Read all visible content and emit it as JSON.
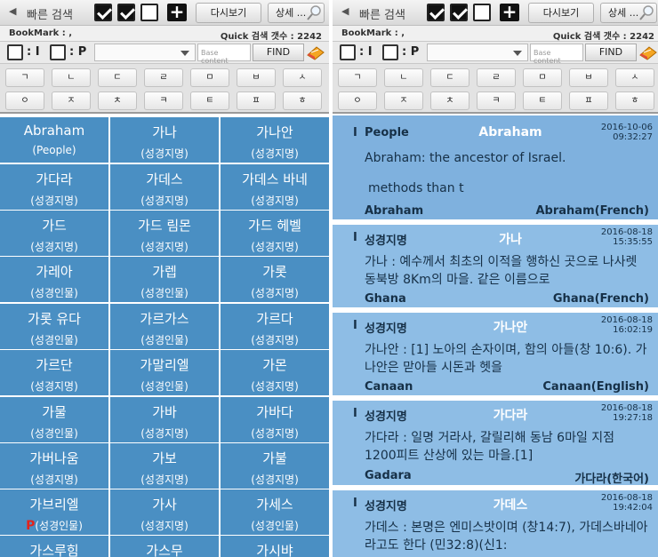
{
  "toolbar": {
    "back_glyph": "◀",
    "title": "빠른 검색",
    "checkboxes": [
      true,
      true,
      false
    ],
    "plus_glyph": "+",
    "review_label": "다시보기",
    "detail_label": "상세 ..."
  },
  "bookmark": {
    "label": "BookMark : ,",
    "quick_count_label": "Quick 검색 갯수 : 2242"
  },
  "search_row": {
    "i_label": ": I",
    "p_label": ": P",
    "placeholder": "Base content",
    "find_label": "FIND"
  },
  "keyboard": {
    "row1": [
      "ㄱ",
      "ㄴ",
      "ㄷ",
      "ㄹ",
      "ㅁ",
      "ㅂ",
      "ㅅ"
    ],
    "row2": [
      "ㅇ",
      "ㅈ",
      "ㅊ",
      "ㅋ",
      "ㅌ",
      "ㅍ",
      "ㅎ"
    ]
  },
  "grid": [
    {
      "name": "Abraham",
      "cat": "(People)",
      "p": ""
    },
    {
      "name": "가나",
      "cat": "(성경지명)",
      "p": ""
    },
    {
      "name": "가나안",
      "cat": "(성경지명)",
      "p": ""
    },
    {
      "name": "가다라",
      "cat": "(성경지명)",
      "p": ""
    },
    {
      "name": "가데스",
      "cat": "(성경지명)",
      "p": ""
    },
    {
      "name": "가데스 바네",
      "cat": "(성경지명)",
      "p": ""
    },
    {
      "name": "가드",
      "cat": "(성경지명)",
      "p": ""
    },
    {
      "name": "가드 림몬",
      "cat": "(성경지명)",
      "p": ""
    },
    {
      "name": "가드 헤벨",
      "cat": "(성경지명)",
      "p": ""
    },
    {
      "name": "가레아",
      "cat": "(성경인물)",
      "p": ""
    },
    {
      "name": "가렙",
      "cat": "(성경인물)",
      "p": ""
    },
    {
      "name": "가롯",
      "cat": "(성경지명)",
      "p": ""
    },
    {
      "name": "가롯 유다",
      "cat": "(성경인물)",
      "p": ""
    },
    {
      "name": "가르가스",
      "cat": "(성경인물)",
      "p": ""
    },
    {
      "name": "가르다",
      "cat": "(성경지명)",
      "p": ""
    },
    {
      "name": "가르단",
      "cat": "(성경지명)",
      "p": ""
    },
    {
      "name": "가말리엘",
      "cat": "(성경인물)",
      "p": ""
    },
    {
      "name": "가몬",
      "cat": "(성경지명)",
      "p": ""
    },
    {
      "name": "가물",
      "cat": "(성경인물)",
      "p": ""
    },
    {
      "name": "가바",
      "cat": "(성경지명)",
      "p": ""
    },
    {
      "name": "가바다",
      "cat": "(성경지명)",
      "p": ""
    },
    {
      "name": "가버나움",
      "cat": "(성경지명)",
      "p": ""
    },
    {
      "name": "가보",
      "cat": "(성경지명)",
      "p": ""
    },
    {
      "name": "가불",
      "cat": "(성경지명)",
      "p": ""
    },
    {
      "name": "가브리엘",
      "cat": "(성경인물)",
      "p": "P"
    },
    {
      "name": "가사",
      "cat": "(성경지명)",
      "p": ""
    },
    {
      "name": "가세스",
      "cat": "(성경인물)",
      "p": ""
    },
    {
      "name": "가스루힘",
      "cat": "",
      "p": ""
    },
    {
      "name": "가스무",
      "cat": "",
      "p": ""
    },
    {
      "name": "가시뱌",
      "cat": "",
      "p": ""
    }
  ],
  "list": [
    {
      "bar": "I",
      "category": "People",
      "name": "Abraham",
      "date": "2016-10-06",
      "time": "09:32:27",
      "desc": "Abraham: the ancestor of Israel.",
      "extra": "methods than t",
      "en": "Abraham",
      "fr": "Abraham(French)"
    },
    {
      "bar": "I",
      "category": "성경지명",
      "name": "가나",
      "date": "2016-08-18",
      "time": "15:35:55",
      "desc": "가나 : 예수께서 최초의 이적을 행하신 곳으로 나사렛 동북방 8Km의 마을. 같은 이름으로",
      "extra": "",
      "en": "Ghana",
      "fr": "Ghana(French)"
    },
    {
      "bar": "I",
      "category": "성경지명",
      "name": "가나안",
      "date": "2016-08-18",
      "time": "16:02:19",
      "desc": "가나안 : [1] 노아의 손자이며, 함의 아들(창 10:6). 가나안은 맏아들 시돈과 헷을",
      "extra": "",
      "en": "Canaan",
      "fr": "Canaan(English)"
    },
    {
      "bar": "I",
      "category": "성경지명",
      "name": "가다라",
      "date": "2016-08-18",
      "time": "19:27:18",
      "desc": "가다라 : 일명 거라사, 갈릴리해 동남 6마일 지점 1200피트 산상에 있는 마을.[1]",
      "extra": "",
      "en": "Gadara",
      "fr": "가다라(한국어)"
    },
    {
      "bar": "I",
      "category": "성경지명",
      "name": "가데스",
      "date": "2016-08-18",
      "time": "19:42:04",
      "desc": "가데스 : 본명은 엔미스밧이며 (창14:7), 가데스바네아라고도 한다 (민32:8)(신1:",
      "extra": "",
      "en": "",
      "fr": ""
    }
  ],
  "colors": {
    "cell_bg": "#4a8fc3",
    "entry_bg": "#8ebde5",
    "name_color": "#ffffff",
    "accent_red": "#e3231c"
  }
}
